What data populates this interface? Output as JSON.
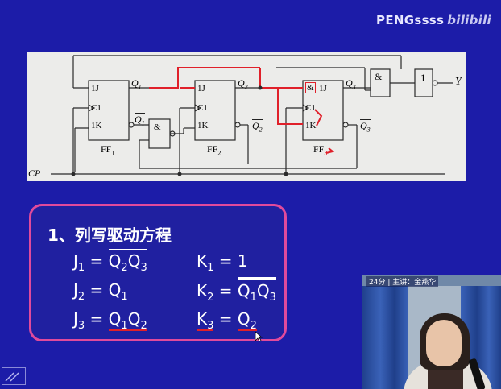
{
  "watermark": {
    "text": "PENGssss",
    "logo": "bilibili"
  },
  "circuit": {
    "q1": "Q",
    "q1_sub": "1",
    "q1n": "Q",
    "q1n_sub": "1",
    "q2": "Q",
    "q2_sub": "2",
    "q2n": "Q",
    "q2n_sub": "2",
    "q3": "Q",
    "q3_sub": "3",
    "q3n": "Q",
    "q3n_sub": "3",
    "ff1_j": "1J",
    "ff1_c": "C1",
    "ff1_k": "1K",
    "ff2_j": "1J",
    "ff2_c": "C1",
    "ff2_k": "1K",
    "ff3_j": "1J",
    "ff3_c": "C1",
    "ff3_k": "1K",
    "ff1_label": "FF",
    "ff1_sub": "1",
    "ff2_label": "FF",
    "ff2_sub": "2",
    "ff3_label": "FF",
    "ff3_sub": "3",
    "and_gate": "&",
    "ff3_and": "&",
    "one_gate": "1",
    "output": "Y",
    "cp": "CP"
  },
  "equations": {
    "title": "1、列写驱动方程",
    "j1_lhs": "J",
    "j1_sub": "1",
    "j1_eq": "=",
    "j1_rhs_a": "Q",
    "j1_rhs_a_sub": "2",
    "j1_rhs_b": "Q",
    "j1_rhs_b_sub": "3",
    "k1_lhs": "K",
    "k1_sub": "1",
    "k1_eq": "= 1",
    "j2_lhs": "J",
    "j2_sub": "2",
    "j2_eq": "=",
    "j2_rhs": "Q",
    "j2_rhs_sub": "1",
    "k2_lhs": "K",
    "k2_sub": "2",
    "k2_eq": "=",
    "k2_rhs_a": "Q",
    "k2_rhs_a_sub": "1",
    "k2_rhs_b": "Q",
    "k2_rhs_b_sub": "3",
    "j3_lhs": "J",
    "j3_sub": "3",
    "j3_eq": "=",
    "j3_rhs_a": "Q",
    "j3_rhs_a_sub": "1",
    "j3_rhs_b": "Q",
    "j3_rhs_b_sub": "2",
    "k3_lhs": "K",
    "k3_sub": "3",
    "k3_eq": "=",
    "k3_rhs": "Q",
    "k3_rhs_sub": "2"
  },
  "video": {
    "caption": "24分 | 主讲：金燕华"
  },
  "colors": {
    "background": "#1c1ca8",
    "panel_border": "#e04a9c",
    "highlight": "#e0202a"
  }
}
